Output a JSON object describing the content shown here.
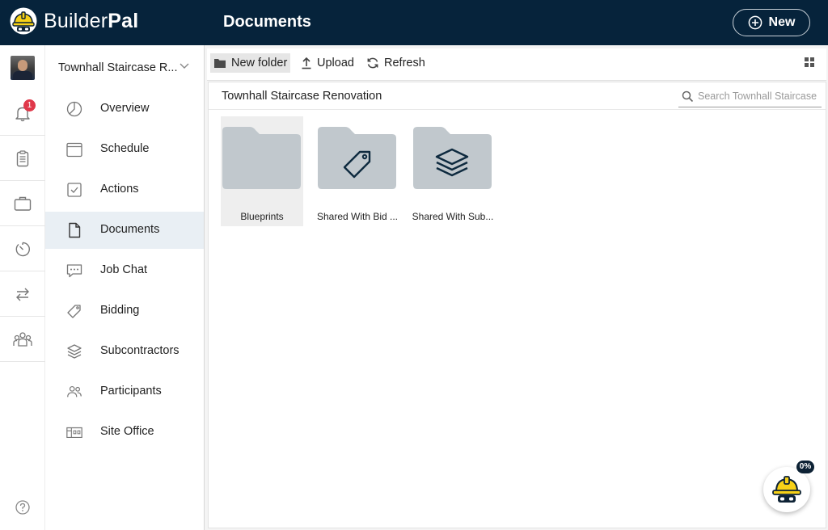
{
  "header": {
    "brand_light": "Builder",
    "brand_bold": "Pal",
    "title": "Documents",
    "new_button": "New"
  },
  "rail": {
    "notification_count": "1",
    "icons": [
      "bell-icon",
      "clipboard-icon",
      "briefcase-icon",
      "stopwatch-icon",
      "swap-icon",
      "team-icon",
      "help-icon"
    ]
  },
  "nav": {
    "project": "Townhall Staircase R...",
    "items": [
      {
        "label": "Overview",
        "icon": "pie-icon"
      },
      {
        "label": "Schedule",
        "icon": "calendar-icon"
      },
      {
        "label": "Actions",
        "icon": "checkbox-icon"
      },
      {
        "label": "Documents",
        "icon": "document-icon",
        "active": true
      },
      {
        "label": "Job Chat",
        "icon": "chat-icon"
      },
      {
        "label": "Bidding",
        "icon": "tag-icon"
      },
      {
        "label": "Subcontractors",
        "icon": "layers-icon"
      },
      {
        "label": "Participants",
        "icon": "people-icon"
      },
      {
        "label": "Site Office",
        "icon": "site-office-icon"
      }
    ]
  },
  "toolbar": {
    "new_folder": "New folder",
    "upload": "Upload",
    "refresh": "Refresh"
  },
  "content": {
    "breadcrumb": "Townhall Staircase Renovation",
    "search_placeholder": "Search Townhall Staircase Renovation",
    "folders": [
      {
        "name": "Blueprints",
        "icon": "folder-icon"
      },
      {
        "name": "Shared With Bid ...",
        "icon": "tag-folder-icon"
      },
      {
        "name": "Shared With Sub...",
        "icon": "layers-folder-icon"
      }
    ]
  },
  "helper": {
    "progress": "0%"
  },
  "colors": {
    "header_bg": "#06233b",
    "active_nav_bg": "#e9eff4",
    "folder_gray": "#c1c8cd",
    "badge_red": "#e0384a",
    "helmet_yellow": "#f7d117"
  }
}
